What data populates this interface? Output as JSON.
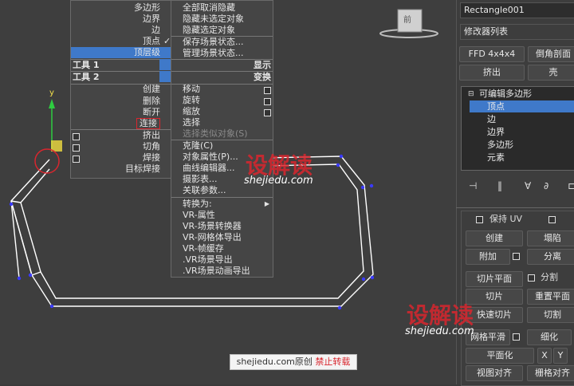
{
  "quad_menu_left": {
    "items_top": [
      "多边形",
      "边界",
      "边",
      "顶点",
      "顶层级"
    ],
    "check_mark": "✓",
    "tool1_label": "工具 1",
    "tool2_label": "工具 2",
    "items_bottom": [
      "创建",
      "删除",
      "断开",
      "连接",
      "挤出",
      "切角",
      "焊接",
      "目标焊接"
    ]
  },
  "quad_menu_right": {
    "items_top": [
      "全部取消隐藏",
      "隐藏未选定对象",
      "隐藏选定对象",
      "保存场景状态...",
      "管理场景状态..."
    ],
    "display_label": "显示",
    "transform_label": "变换",
    "items_transform": [
      "移动",
      "旋转",
      "缩放",
      "选择",
      "选择类似对象(S)",
      "克隆(C)",
      "对象属性(P)...",
      "曲线编辑器...",
      "摄影表...",
      "关联参数..."
    ],
    "items_convert": [
      "转换为:",
      "VR-属性",
      "VR-场景转换器",
      "VR-网格体导出",
      "VR-帧缓存",
      ".VR场景导出",
      ".VR场景动画导出"
    ]
  },
  "viewport": {
    "axis_y_label": "y",
    "viewcube_label": "前"
  },
  "command_panel": {
    "object_name": "Rectangle001",
    "modifier_list": "修改器列表",
    "btn_ffd": "FFD 4x4x4",
    "btn_bevel_profile": "倒角剖面",
    "btn_extrude": "挤出",
    "btn_shell": "壳",
    "stack_items": [
      "可编辑多边形",
      "顶点",
      "边",
      "边界",
      "多边形",
      "元素"
    ],
    "keep_uv": "保持 UV",
    "btn_create": "创建",
    "btn_collapse": "塌陷",
    "btn_attach": "附加",
    "btn_detach": "分离",
    "btn_slice_plane": "切片平面",
    "cb_split": "分割",
    "btn_slice": "切片",
    "btn_reset_plane": "重置平面",
    "btn_quickslice": "快速切片",
    "btn_cut": "切割",
    "btn_meshsmooth": "网格平滑",
    "btn_tessellate": "细化",
    "btn_planarize": "平面化",
    "btn_x": "X",
    "btn_y": "Y",
    "btn_view_align": "视图对齐",
    "btn_grid_align": "栅格对齐"
  },
  "watermark": {
    "logo": "设解读",
    "url": "shejiedu.com",
    "caption_site": "shejiedu.com",
    "caption_original": "原创",
    "caption_no_repost": "禁止转载"
  },
  "colors": {
    "highlight": "#3f79c9",
    "watermark_red": "#d9262e",
    "geometry_white": "#ffffff",
    "vertex_blue": "#3a3aff"
  }
}
